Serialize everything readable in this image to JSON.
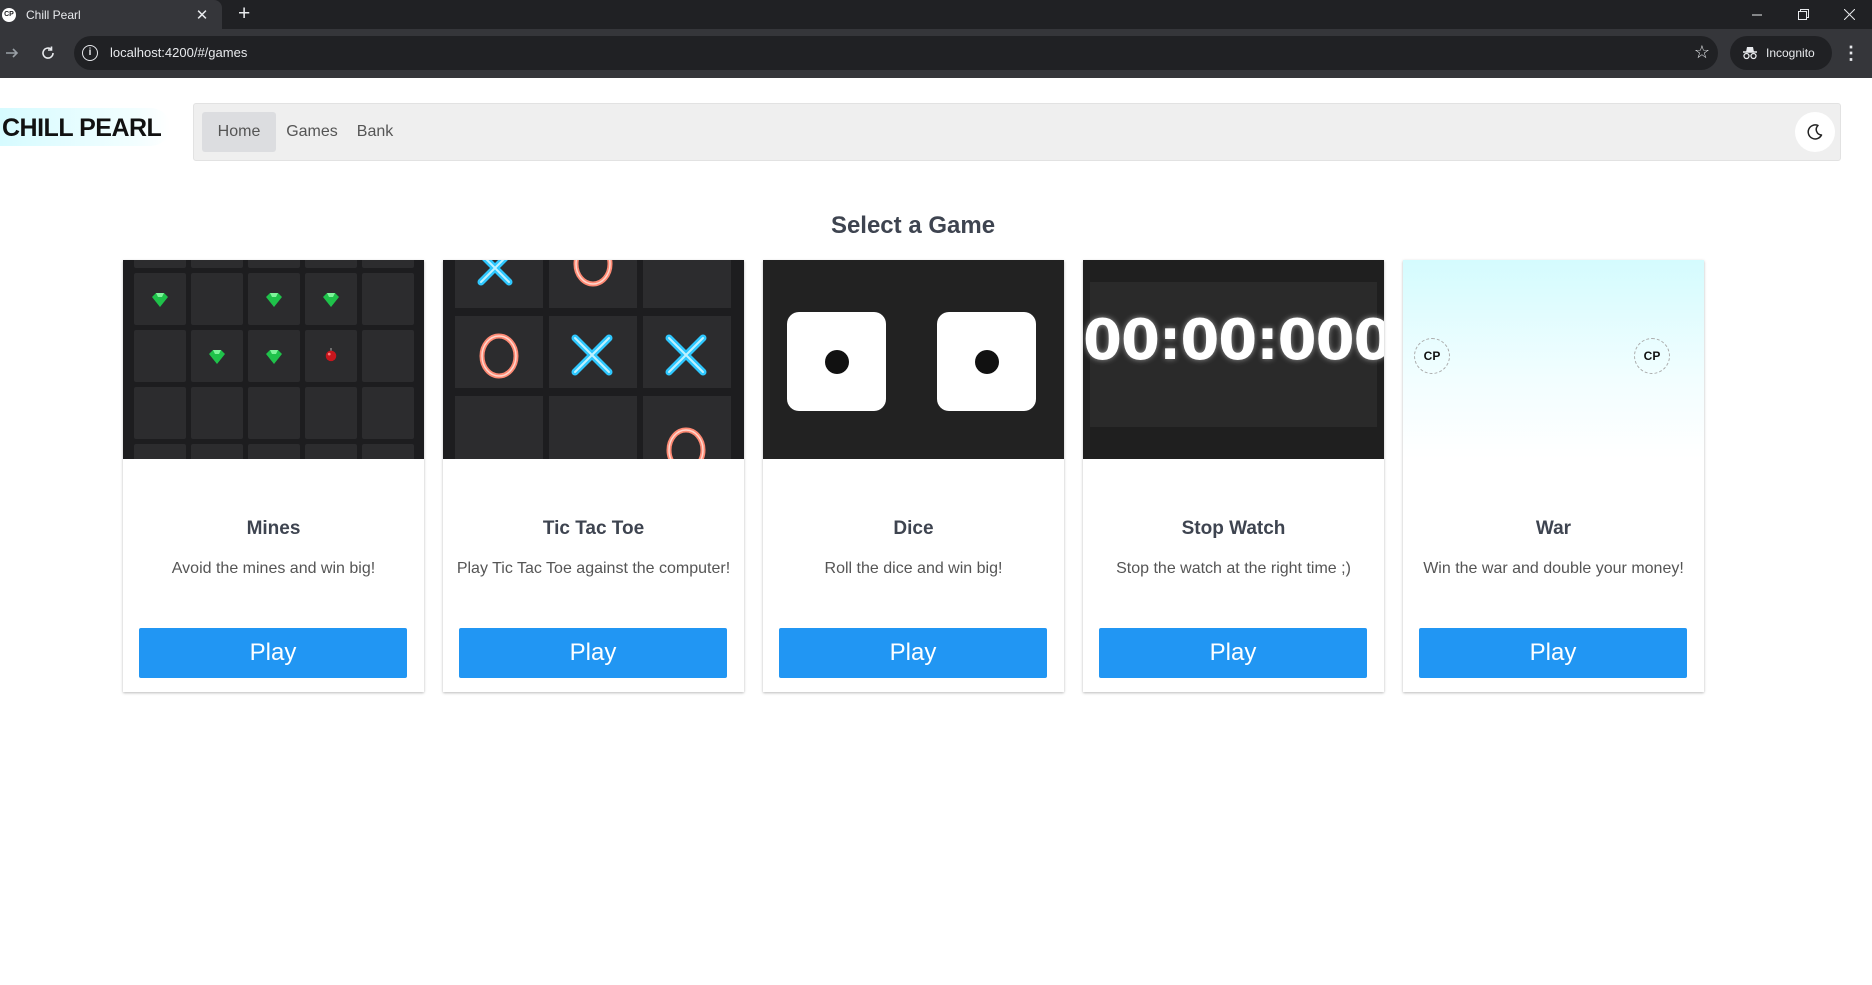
{
  "browser": {
    "tab_title": "Chill Pearl",
    "favicon_text": "CP",
    "url": "localhost:4200/#/games",
    "incognito_label": "Incognito"
  },
  "app": {
    "logo": "CHILL PEARL",
    "nav": [
      {
        "label": "Home",
        "active": true
      },
      {
        "label": "Games",
        "active": false
      },
      {
        "label": "Bank",
        "active": false
      }
    ],
    "theme_icon": "moon-icon"
  },
  "main": {
    "heading": "Select a Game",
    "games": [
      {
        "title": "Mines",
        "description": "Avoid the mines and win big!",
        "button": "Play"
      },
      {
        "title": "Tic Tac Toe",
        "description": "Play Tic Tac Toe against the computer!",
        "button": "Play"
      },
      {
        "title": "Dice",
        "description": "Roll the dice and win big!",
        "button": "Play"
      },
      {
        "title": "Stop Watch",
        "description": "Stop the watch at the right time ;)",
        "button": "Play"
      },
      {
        "title": "War",
        "description": "Win the war and double your money!",
        "button": "Play"
      }
    ],
    "stopwatch_display": "00:00:000",
    "war_token_text": "CP"
  },
  "colors": {
    "accent": "#2196f3",
    "navbar_bg": "#efefef",
    "card_image_dark": "#1d1d1f"
  }
}
